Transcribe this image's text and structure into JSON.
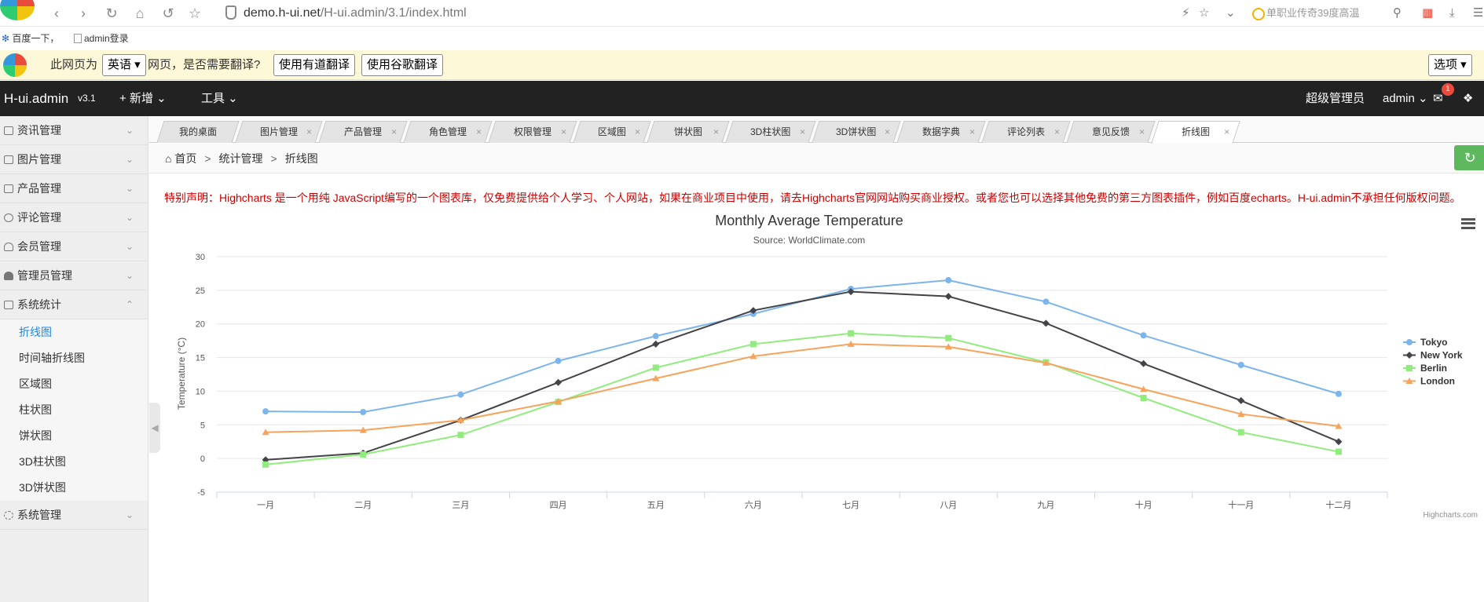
{
  "browser": {
    "url_host": "demo.h-ui.net",
    "url_path": "/H-ui.admin/3.1/index.html",
    "search_text": "单职业传奇39度高温",
    "bookmarks": [
      "百度一下，",
      "admin登录"
    ]
  },
  "translate_bar": {
    "prefix": "此网页为",
    "language": "英语",
    "question": "网页，是否需要翻译?",
    "btn_youdao": "使用有道翻译",
    "btn_google": "使用谷歌翻译",
    "options": "选项"
  },
  "header": {
    "logo": "H-ui.admin",
    "version": "v3.1",
    "nav_add": "新增",
    "nav_tools": "工具",
    "role": "超级管理员",
    "user": "admin",
    "msg_count": "1"
  },
  "sidebar": {
    "menus": [
      {
        "label": "资讯管理"
      },
      {
        "label": "图片管理"
      },
      {
        "label": "产品管理"
      },
      {
        "label": "评论管理"
      },
      {
        "label": "会员管理"
      },
      {
        "label": "管理员管理"
      },
      {
        "label": "系统统计"
      }
    ],
    "sub_items": [
      "折线图",
      "时间轴折线图",
      "区域图",
      "柱状图",
      "饼状图",
      "3D柱状图",
      "3D饼状图"
    ],
    "last_menu": "系统管理"
  },
  "tabs": [
    "我的桌面",
    "图片管理",
    "产品管理",
    "角色管理",
    "权限管理",
    "区域图",
    "饼状图",
    "3D柱状图",
    "3D饼状图",
    "数据字典",
    "评论列表",
    "意见反馈",
    "折线图"
  ],
  "breadcrumb": {
    "home": "首页",
    "section": "统计管理",
    "page": "折线图"
  },
  "notice": "特别声明：Highcharts 是一个用纯 JavaScript编写的一个图表库，仅免费提供给个人学习、个人网站，如果在商业项目中使用，请去Highcharts官网网站购买商业授权。或者您也可以选择其他免费的第三方图表插件，例如百度echarts。H-ui.admin不承担任何版权问题。",
  "colors": {
    "tokyo": "#7cb5ec",
    "newyork": "#434348",
    "berlin": "#90ed7d",
    "london": "#f7a35c"
  },
  "chart_data": {
    "type": "line",
    "title": "Monthly Average Temperature",
    "subtitle": "Source: WorldClimate.com",
    "xlabel": "",
    "ylabel": "Temperature (°C)",
    "ylim": [
      -5,
      30
    ],
    "yticks": [
      30,
      25,
      20,
      15,
      10,
      5,
      0,
      -5
    ],
    "categories": [
      "一月",
      "二月",
      "三月",
      "四月",
      "五月",
      "六月",
      "七月",
      "八月",
      "九月",
      "十月",
      "十一月",
      "十二月"
    ],
    "series": [
      {
        "name": "Tokyo",
        "values": [
          7.0,
          6.9,
          9.5,
          14.5,
          18.2,
          21.5,
          25.2,
          26.5,
          23.3,
          18.3,
          13.9,
          9.6
        ]
      },
      {
        "name": "New York",
        "values": [
          -0.2,
          0.8,
          5.7,
          11.3,
          17.0,
          22.0,
          24.8,
          24.1,
          20.1,
          14.1,
          8.6,
          2.5
        ]
      },
      {
        "name": "Berlin",
        "values": [
          -0.9,
          0.6,
          3.5,
          8.4,
          13.5,
          17.0,
          18.6,
          17.9,
          14.3,
          9.0,
          3.9,
          1.0
        ]
      },
      {
        "name": "London",
        "values": [
          3.9,
          4.2,
          5.7,
          8.5,
          11.9,
          15.2,
          17.0,
          16.6,
          14.2,
          10.3,
          6.6,
          4.8
        ]
      }
    ],
    "legend_position": "right",
    "credits": "Highcharts.com",
    "grid": true
  }
}
